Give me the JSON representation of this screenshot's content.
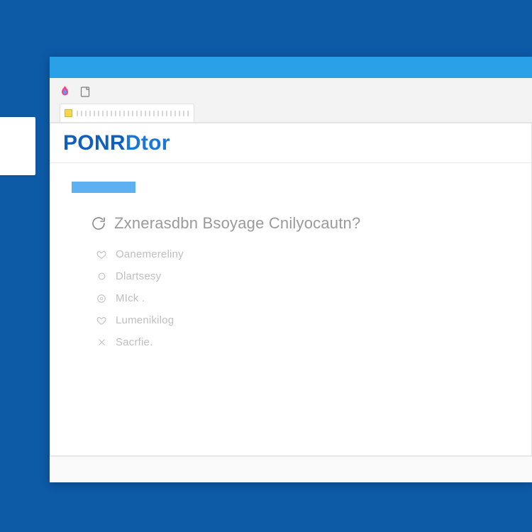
{
  "app": {
    "title_a": "PONR",
    "title_b": "Dtor"
  },
  "tab": {
    "label_placeholder": ""
  },
  "page": {
    "heading": "Zxnerasdbn Bsoyage Cnilyocautn?"
  },
  "list": {
    "items": [
      {
        "label": "Oanemereliny"
      },
      {
        "label": "Dlartsesy"
      },
      {
        "label": "MIck ."
      },
      {
        "label": "Lumenikilog"
      },
      {
        "label": "Sacrfie."
      }
    ]
  }
}
